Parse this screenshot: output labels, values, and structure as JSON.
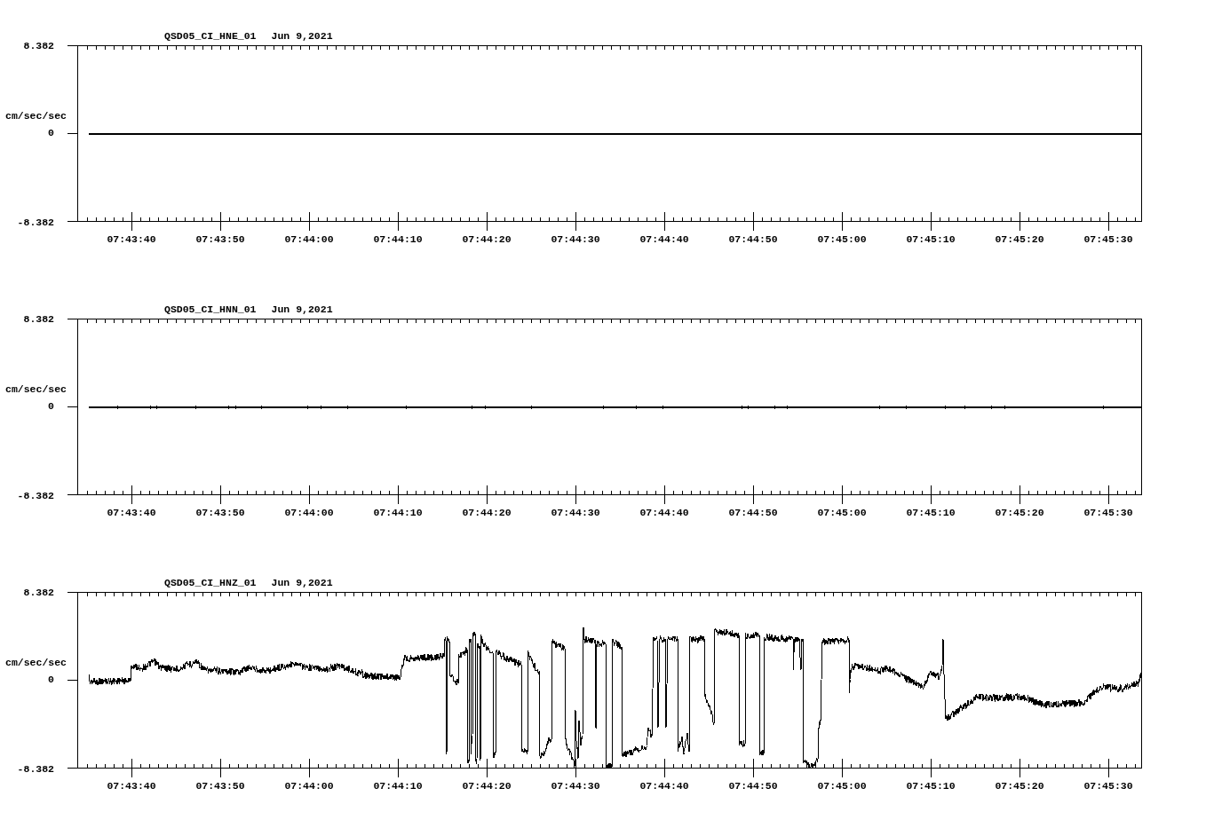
{
  "panels": [
    {
      "kind": "flat",
      "station": "QSD05_CI_HNE_01",
      "date": "Jun 9,2021",
      "unit": "cm/sec/sec",
      "y_ticks": [
        "8.382",
        "0",
        "-8.382"
      ],
      "x_ticks": [
        "07:43:40",
        "07:43:50",
        "07:44:00",
        "07:44:10",
        "07:44:20",
        "07:44:30",
        "07:44:40",
        "07:44:50",
        "07:45:00",
        "07:45:10",
        "07:45:20",
        "07:45:30"
      ]
    },
    {
      "kind": "quiet",
      "station": "QSD05_CI_HNN_01",
      "date": "Jun 9,2021",
      "unit": "cm/sec/sec",
      "y_ticks": [
        "8.382",
        "0",
        "-8.382"
      ],
      "x_ticks": [
        "07:43:40",
        "07:43:50",
        "07:44:00",
        "07:44:10",
        "07:44:20",
        "07:44:30",
        "07:44:40",
        "07:44:50",
        "07:45:00",
        "07:45:10",
        "07:45:20",
        "07:45:30"
      ]
    },
    {
      "kind": "active",
      "station": "QSD05_CI_HNZ_01",
      "date": "Jun 9,2021",
      "unit": "cm/sec/sec",
      "y_ticks": [
        "8.382",
        "0",
        "-8.382"
      ],
      "x_ticks": [
        "07:43:40",
        "07:43:50",
        "07:44:00",
        "07:44:10",
        "07:44:20",
        "07:44:30",
        "07:44:40",
        "07:44:50",
        "07:45:00",
        "07:45:10",
        "07:45:20",
        "07:45:30"
      ]
    }
  ]
}
